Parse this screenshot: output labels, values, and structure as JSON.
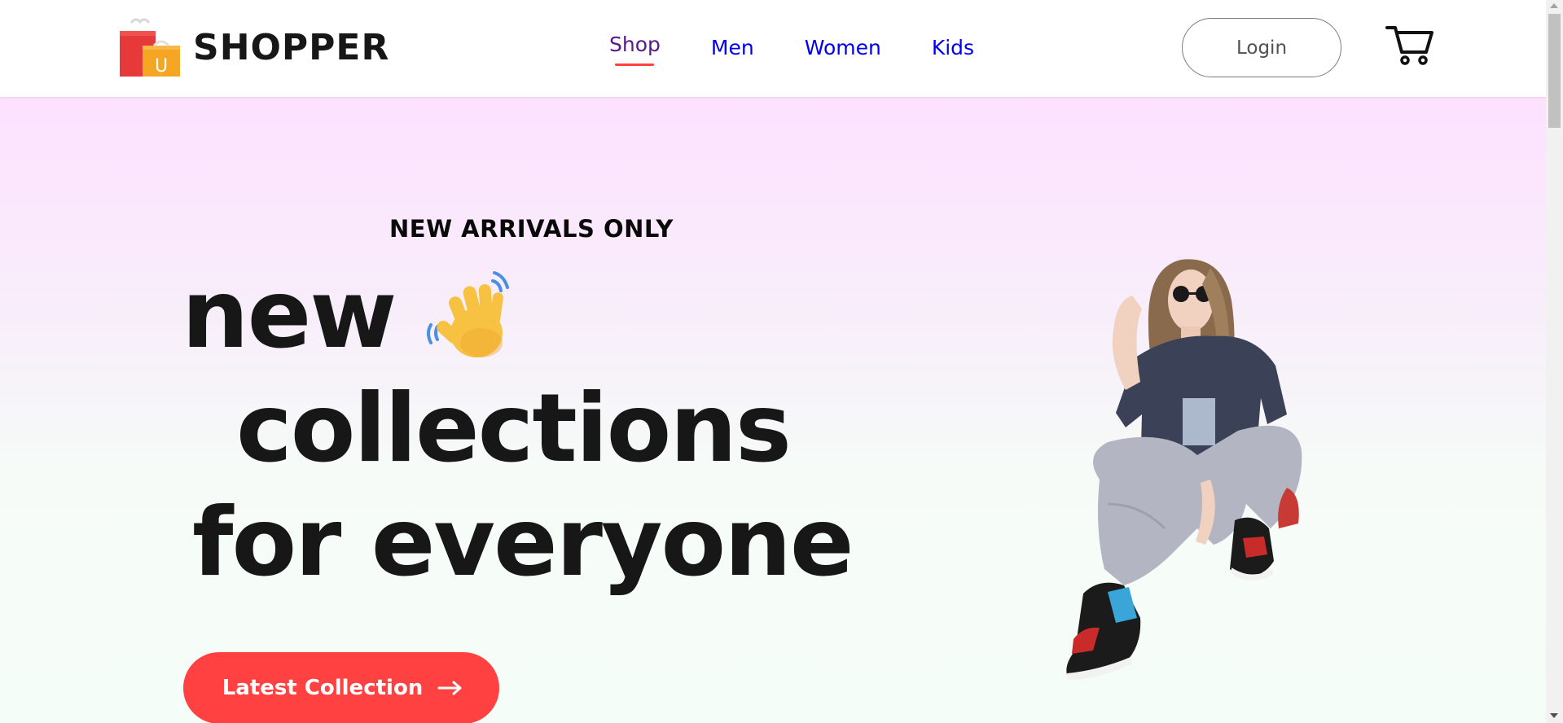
{
  "brand": {
    "name": "SHOPPER"
  },
  "nav": {
    "items": [
      {
        "label": "Shop",
        "active": true
      },
      {
        "label": "Men",
        "active": false
      },
      {
        "label": "Women",
        "active": false
      },
      {
        "label": "Kids",
        "active": false
      }
    ],
    "login_label": "Login"
  },
  "hero": {
    "tagline": "NEW ARRIVALS ONLY",
    "line1": "new",
    "line2": "collections",
    "line3": "for everyone",
    "cta_label": "Latest Collection"
  },
  "colors": {
    "accent": "#ff4141",
    "hero_top": "#fde1ff",
    "hero_bottom": "#f5fdf8",
    "text_dark": "#171717"
  },
  "icons": {
    "logo": "shopping-bags-icon",
    "cart": "cart-icon",
    "hand": "waving-hand-icon",
    "cta_arrow": "arrow-right-icon"
  }
}
